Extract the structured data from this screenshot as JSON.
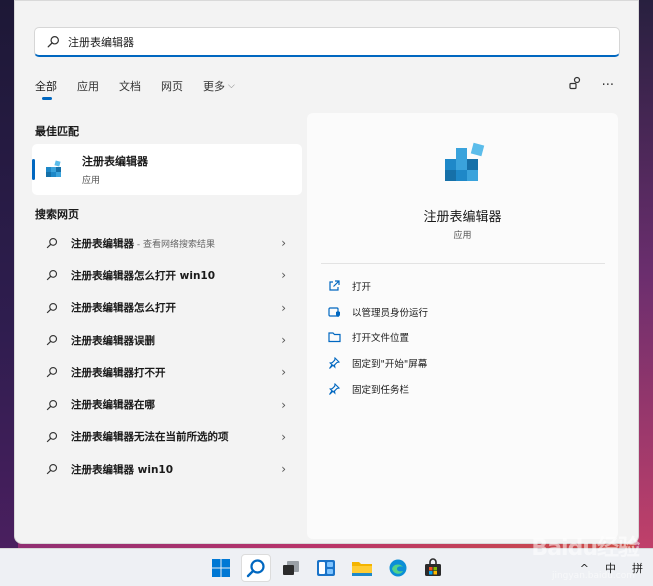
{
  "search": {
    "value": "注册表编辑器"
  },
  "tabs": [
    "全部",
    "应用",
    "文档",
    "网页",
    "更多"
  ],
  "top_icons": [
    "share-icon",
    "more-icon"
  ],
  "best_match": {
    "section": "最佳匹配",
    "name": "注册表编辑器",
    "type": "应用"
  },
  "web_search": {
    "section": "搜索网页",
    "items": [
      {
        "text": "注册表编辑器",
        "sub": " - 查看网络搜索结果"
      },
      {
        "text": "注册表编辑器怎么打开 win10",
        "sub": ""
      },
      {
        "text": "注册表编辑器怎么打开",
        "sub": ""
      },
      {
        "text": "注册表编辑器误删",
        "sub": ""
      },
      {
        "text": "注册表编辑器打不开",
        "sub": ""
      },
      {
        "text": "注册表编辑器在哪",
        "sub": ""
      },
      {
        "text": "注册表编辑器无法在当前所选的项",
        "sub": ""
      },
      {
        "text": "注册表编辑器 win10",
        "sub": ""
      }
    ]
  },
  "detail": {
    "name": "注册表编辑器",
    "type": "应用",
    "actions": [
      {
        "label": "打开",
        "icon": "open-icon"
      },
      {
        "label": "以管理员身份运行",
        "icon": "admin-icon"
      },
      {
        "label": "打开文件位置",
        "icon": "folder-icon"
      },
      {
        "label": "固定到\"开始\"屏幕",
        "icon": "pin-icon"
      },
      {
        "label": "固定到任务栏",
        "icon": "pin-icon"
      }
    ]
  },
  "taskbar": {
    "apps": [
      "windows-start-icon",
      "search-icon",
      "task-view-icon",
      "widgets-icon",
      "file-explorer-icon",
      "edge-icon",
      "store-icon"
    ],
    "tray_chevron": "^",
    "ime": "中",
    "ime2": "拼"
  },
  "watermark": {
    "main": "Baidu经验",
    "sub": "jingyan.baidu.com"
  }
}
